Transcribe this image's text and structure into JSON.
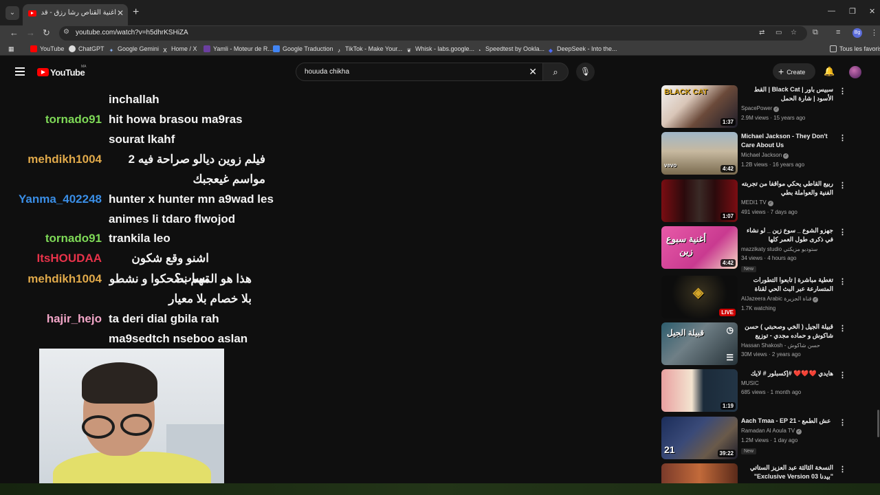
{
  "browser": {
    "tab_title": "أغنية القناص رشا رزق - قد ممعت",
    "url": "youtube.com/watch?v=h5dhrKSHiZA",
    "profile_initials": "Bg",
    "bookmarks": [
      "YouTube",
      "ChatGPT",
      "Google Gemini",
      "Home / X",
      "Yamli - Moteur de R...",
      "Google Traduction",
      "TikTok - Make Your...",
      "Whisk - labs.google...",
      "Speedtest by Ookla...",
      "DeepSeek - Into the..."
    ],
    "all_bookmarks": "Tous les favoris"
  },
  "youtube": {
    "logo": "YouTube",
    "country": "MA",
    "search_value": "houuda chikha",
    "create_label": "Create"
  },
  "chat": [
    {
      "user": "",
      "text": "inchallah",
      "color": "#ffffff"
    },
    {
      "user": "tornado91",
      "text": "hit howa brasou ma9ras sourat lkahf",
      "color": "#7ed957"
    },
    {
      "user": "mehdikh1004",
      "text": "فيلم زوين ديالو صراحة فيه 2 مواسم غيعجبك",
      "color": "#e0a94a"
    },
    {
      "user": "Yanma_402248",
      "text": "hunter x hunter mn a9wad les animes li tdaro flwojod",
      "color": "#3a8ee6"
    },
    {
      "user": "tornado91",
      "text": "trankila leo",
      "color": "#7ed957"
    },
    {
      "user": "ItsHOUDAA",
      "text": "اشنو وقع شكون تساب؟",
      "color": "#e8334a"
    },
    {
      "user": "mehdikh1004",
      "text": "هذا هو المهم نضحكوا و نشطو بلا خصام بلا معيار",
      "color": "#e0a94a"
    },
    {
      "user": "hajir_hejo",
      "text": "ta deri dial gbila rah ma9sedtch nseboo aslan",
      "color": "#f3a6c8"
    }
  ],
  "sidebar": [
    {
      "title": "سبيس باور | Black Cat | القط الأسود | شارة الحمل",
      "channel": "SpacePower",
      "views": "2.9M views · 15 years ago",
      "duration": "1:37",
      "verified": true,
      "badge": ""
    },
    {
      "title": "Michael Jackson - They Don't Care About Us",
      "channel": "Michael Jackson",
      "views": "1.2B views · 16 years ago",
      "duration": "4:42",
      "verified": true,
      "badge": ""
    },
    {
      "title": "ربيع القاطي يحكي مواقفا من تجربته الفنية والعواملة بطي",
      "channel": "MEDI1 TV",
      "views": "491 views · 7 days ago",
      "duration": "1:07",
      "verified": true,
      "badge": ""
    },
    {
      "title": "جهزو الشوع _ سوع زين _ لو نشاء في ذكرى طول العمر كلها",
      "channel": "mazzikaty studio ستوديو مزيكتي",
      "views": "34 views · 4 hours ago",
      "duration": "4:42",
      "verified": false,
      "badge": "New",
      "thumb_text": "أغنية سبوع زين"
    },
    {
      "title": "تغطية مباشرة | تابعوا التطورات المتسارعة عبر البث الحي لقناة الجزيرة",
      "channel": "AlJazeera Arabic قناة الجزيرة",
      "views": "1.7K watching",
      "duration": "LIVE",
      "verified": true,
      "badge": ""
    },
    {
      "title": "قبيلة الجيل ( الخي وصحبتي ) حسن شاكوش و حماده مجدي - توزيع اسلام ساسو من...",
      "channel": "Hassan Shakosh - حسن شاكوش",
      "views": "30M views · 2 years ago",
      "duration": "",
      "verified": false,
      "badge": ""
    },
    {
      "title": "هايدي ❤️❤️❤️ #إكسبلور # لايك",
      "channel": "MUSIC",
      "views": "685 views · 1 month ago",
      "duration": "1:19",
      "verified": false,
      "badge": ""
    },
    {
      "title": "Aach Tmaa - EP 21 - عش الطمع",
      "channel": "Ramadan Al Aoula TV",
      "views": "1.2M views · 1 day ago",
      "duration": "39:22",
      "verified": true,
      "badge": "New"
    },
    {
      "title": "النسخة الثالثة عبد العزيز الستاتي \"بيدنا Exclusive Version 03\"",
      "channel": "",
      "views": "",
      "duration": "",
      "verified": false,
      "badge": ""
    }
  ]
}
